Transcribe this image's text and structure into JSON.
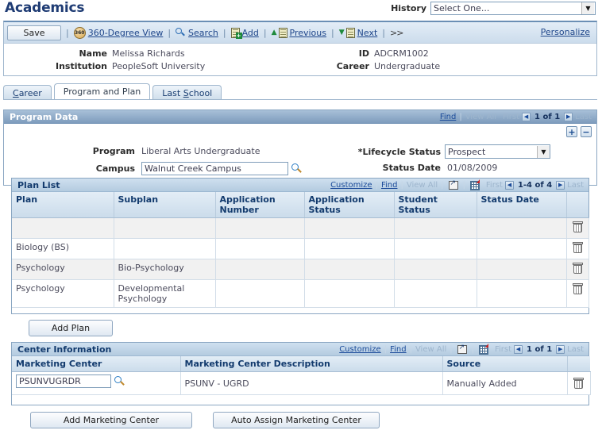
{
  "header": {
    "title": "Academics",
    "history_label": "History",
    "history_value": "Select One...",
    "history_caret_icon": "chevron-down-icon"
  },
  "toolbar": {
    "save_label": "Save",
    "separator": "|",
    "items": [
      {
        "label": "360-Degree View",
        "icon": "360-degree-icon"
      },
      {
        "label": "Search",
        "icon": "search-icon"
      },
      {
        "label": "Add",
        "icon": "add-list-icon"
      },
      {
        "label": "Previous",
        "icon": "previous-arrow-icon"
      },
      {
        "label": "Next",
        "icon": "next-arrow-icon"
      }
    ],
    "more_label": ">>",
    "personalize_label": "Personalize"
  },
  "identity": {
    "left": [
      {
        "label": "Name",
        "value": "Melissa Richards"
      },
      {
        "label": "Institution",
        "value": "PeopleSoft University"
      }
    ],
    "right": [
      {
        "label": "ID",
        "value": "ADCRM1002"
      },
      {
        "label": "Career",
        "value": "Undergraduate"
      }
    ]
  },
  "tabs": [
    {
      "label": "Career",
      "accel": "C",
      "active": false
    },
    {
      "label": "Program and Plan",
      "accel": "",
      "active": true
    },
    {
      "label": "Last School",
      "accel": "S",
      "active": false
    }
  ],
  "program_data": {
    "title": "Program Data",
    "nav": {
      "find": "Find",
      "view_all": "View All",
      "first": "First",
      "count": "1 of 1",
      "last": "Last",
      "prev_icon": "nav-prev-icon",
      "next_icon": "nav-next-icon"
    },
    "add_row_label": "+",
    "del_row_label": "−",
    "fields": {
      "program_label": "Program",
      "program_value": "Liberal Arts Undergraduate",
      "campus_label": "Campus",
      "campus_value": "Walnut Creek Campus",
      "campus_lookup_icon": "lookup-icon",
      "lifecycle_label": "*Lifecycle Status",
      "lifecycle_value": "Prospect",
      "lifecycle_caret_icon": "chevron-down-icon",
      "status_date_label": "Status Date",
      "status_date_value": "01/08/2009"
    }
  },
  "plan_list": {
    "title": "Plan List",
    "nav": {
      "customize": "Customize",
      "find": "Find",
      "view_all": "View All",
      "expand_icon": "expand-icon",
      "download_icon": "download-spreadsheet-icon",
      "first": "First",
      "count": "1-4 of 4",
      "last": "Last"
    },
    "columns": [
      "Plan",
      "Subplan",
      "Application Number",
      "Application Status",
      "Student Status",
      "Status Date",
      ""
    ],
    "rows": [
      {
        "plan": "",
        "subplan": "",
        "application_number": "",
        "application_status": "",
        "student_status": "",
        "status_date": "",
        "delete_icon": "trash-icon"
      },
      {
        "plan": "Biology (BS)",
        "subplan": "",
        "application_number": "",
        "application_status": "",
        "student_status": "",
        "status_date": "",
        "delete_icon": "trash-icon"
      },
      {
        "plan": "Psychology",
        "subplan": "Bio-Psychology",
        "application_number": "",
        "application_status": "",
        "student_status": "",
        "status_date": "",
        "delete_icon": "trash-icon"
      },
      {
        "plan": "Psychology",
        "subplan": "Developmental Psychology",
        "application_number": "",
        "application_status": "",
        "student_status": "",
        "status_date": "",
        "delete_icon": "trash-icon"
      }
    ],
    "add_plan_label": "Add Plan"
  },
  "center_information": {
    "title": "Center Information",
    "nav": {
      "customize": "Customize",
      "find": "Find",
      "view_all": "View All",
      "expand_icon": "expand-icon",
      "download_icon": "download-spreadsheet-icon",
      "first": "First",
      "count": "1 of 1",
      "last": "Last"
    },
    "columns": [
      "Marketing Center",
      "Marketing Center Description",
      "Source",
      ""
    ],
    "rows": [
      {
        "marketing_center": "PSUNVUGRDR",
        "lookup_icon": "lookup-icon",
        "description": "PSUNV - UGRD",
        "source": "Manually Added",
        "delete_icon": "trash-icon"
      }
    ],
    "add_button_label": "Add Marketing Center",
    "auto_assign_button_label": "Auto Assign Marketing Center"
  },
  "colors": {
    "title_blue": "#1f3c74",
    "group_header_blue": "#7e9cbd",
    "grid_header_blue": "#b4cbe0",
    "link_blue": "#20478b",
    "alt_row": "#f1f1f1"
  }
}
